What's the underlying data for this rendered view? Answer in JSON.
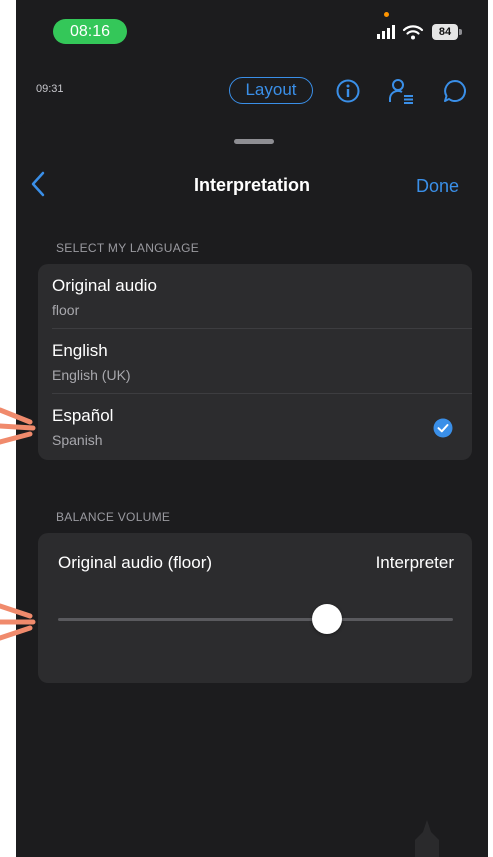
{
  "status_bar": {
    "time": "08:16",
    "battery": "84",
    "icons": [
      "cellular-signal-icon",
      "wifi-icon",
      "battery-icon"
    ]
  },
  "meeting_bar": {
    "meeting_time": "09:31",
    "layout_label": "Layout",
    "icons": [
      "info-icon",
      "participants-icon",
      "chat-icon"
    ]
  },
  "sheet": {
    "title": "Interpretation",
    "done_label": "Done",
    "back_icon": "chevron-left-icon"
  },
  "language_section": {
    "header": "SELECT MY LANGUAGE",
    "options": [
      {
        "title": "Original audio",
        "subtitle": "floor",
        "selected": false
      },
      {
        "title": "English",
        "subtitle": "English (UK)",
        "selected": false
      },
      {
        "title": "Español",
        "subtitle": "Spanish",
        "selected": true
      }
    ]
  },
  "balance_section": {
    "header": "BALANCE VOLUME",
    "left_label": "Original audio (floor)",
    "right_label": "Interpreter",
    "slider_value": 0.68
  },
  "colors": {
    "accent": "#3a8fe8",
    "time_pill": "#34c759",
    "background": "#1c1c1e",
    "card": "#2c2c2e",
    "annotation_arrow": "#f08a6c"
  }
}
